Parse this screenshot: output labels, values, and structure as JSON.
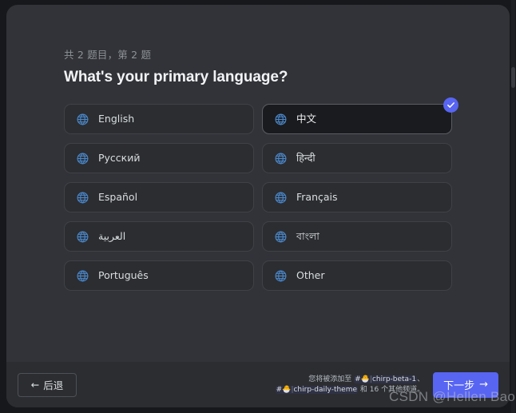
{
  "modal": {
    "step_counter": "共 2 题目，第 2 题",
    "question_title": "What's your primary language?",
    "options": [
      {
        "label": "English",
        "icon": "globe-icon",
        "selected": false
      },
      {
        "label": "中文",
        "icon": "globe-icon",
        "selected": true
      },
      {
        "label": "Русский",
        "icon": "globe-icon",
        "selected": false
      },
      {
        "label": "हिन्दी",
        "icon": "globe-icon",
        "selected": false
      },
      {
        "label": "Español",
        "icon": "globe-icon",
        "selected": false
      },
      {
        "label": "Français",
        "icon": "globe-icon",
        "selected": false
      },
      {
        "label": "العربية",
        "icon": "globe-icon",
        "selected": false
      },
      {
        "label": "বাংলা",
        "icon": "globe-icon",
        "selected": false
      },
      {
        "label": "Português",
        "icon": "globe-icon",
        "selected": false
      },
      {
        "label": "Other",
        "icon": "globe-icon",
        "selected": false
      }
    ],
    "selected_badge_icon": "check-icon"
  },
  "footer": {
    "back_label": "后退",
    "back_icon": "arrow-left-icon",
    "next_label": "下一步",
    "next_icon": "arrow-right-icon",
    "note_prefix": "您将被添加至 ",
    "channel_1": {
      "hash": "#",
      "emoji": "🐣",
      "bar": "|",
      "name": "chirp-beta-1"
    },
    "note_separator": "、",
    "channel_2": {
      "hash": "#",
      "emoji": "🐣",
      "bar": "|",
      "name": "chirp-daily-theme"
    },
    "note_suffix": " 和 16 个其他频道。"
  },
  "watermark": "CSDN @Hellen Bao",
  "colors": {
    "accent": "#5865f2",
    "modal_bg": "#313338",
    "footer_bg": "#2b2d31",
    "card_bg": "#2b2d31",
    "card_selected_bg": "#1a1b1e",
    "card_border": "#3f4147",
    "globe_icon": "#4a86c8",
    "title_text": "#f2f3f5",
    "muted_text": "#8e9297"
  }
}
